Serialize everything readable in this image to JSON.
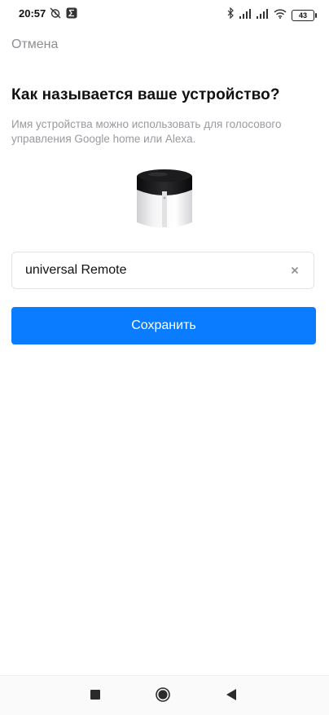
{
  "status_bar": {
    "time": "20:57",
    "battery": "43",
    "icons": [
      "alarm-off-icon",
      "app-notification-icon",
      "bluetooth-icon",
      "signal-icon",
      "signal-icon",
      "wifi-icon",
      "battery-icon"
    ]
  },
  "header": {
    "cancel_label": "Отмена"
  },
  "main": {
    "title": "Как называется ваше устройство?",
    "description": "Имя устройства можно использовать для голосового управления Google home или Alexa.",
    "device_image": "ir-remote-hub-image",
    "name_input": {
      "value": "universal Remote",
      "clear_icon": "close-icon"
    },
    "save_label": "Сохранить"
  },
  "nav_bar": {
    "items": [
      "recents-icon",
      "home-icon",
      "back-icon"
    ]
  },
  "colors": {
    "accent": "#0a7cff",
    "muted_text": "#9a9a9f",
    "background": "#ffffff"
  }
}
